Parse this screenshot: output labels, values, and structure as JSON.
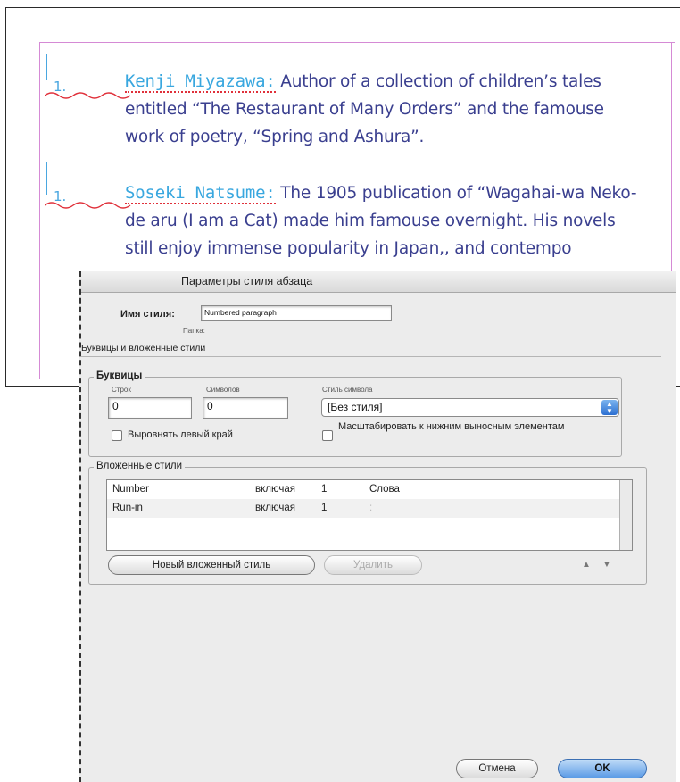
{
  "document": {
    "paragraph1": {
      "number": "1.",
      "name": "Kenji Miyazawa:",
      "text": " Author of a collection of children’s tales entitled “The Restaurant of Many Orders” and the famouse work of poetry, “Spring and Ashura”."
    },
    "paragraph2": {
      "number": "1.",
      "name": "Soseki Natsume:",
      "text": " The 1905 publication of “Wagahai-wa Neko-de aru (I am a Cat) made him famouse overnight. His novels still enjoy immense popularity in Japan,, and contempo"
    }
  },
  "dialog": {
    "title": "Параметры стиля абзаца",
    "style_name_label": "Имя стиля:",
    "style_name_value": "Numbered paragraph",
    "folder_label": "Папка:",
    "section_title": "Буквицы и вложенные стили",
    "dropcaps": {
      "title": "Буквицы",
      "lines_label": "Строк",
      "lines_value": "0",
      "chars_label": "Символов",
      "chars_value": "0",
      "char_style_label": "Стиль символа",
      "char_style_value": "[Без стиля]",
      "align_left_label": "Выровнять левый край",
      "scale_descenders_label": "Масштабировать к нижним выносным элементам"
    },
    "nested": {
      "title": "Вложенные стили",
      "rows": [
        {
          "style": "Number",
          "mode": "включая",
          "count": "1",
          "unit": "Слова"
        },
        {
          "style": "Run-in",
          "mode": "включая",
          "count": "1",
          "unit": ":"
        }
      ],
      "new_button": "Новый вложенный стиль",
      "delete_button": "Удалить"
    },
    "cancel_button": "Отмена",
    "ok_button": "OK"
  },
  "colors": {
    "accent_blue": "#39a7df",
    "body_text": "#3a3f8f",
    "guide_magenta": "#d58ad5",
    "squiggle_red": "#e0303a"
  }
}
